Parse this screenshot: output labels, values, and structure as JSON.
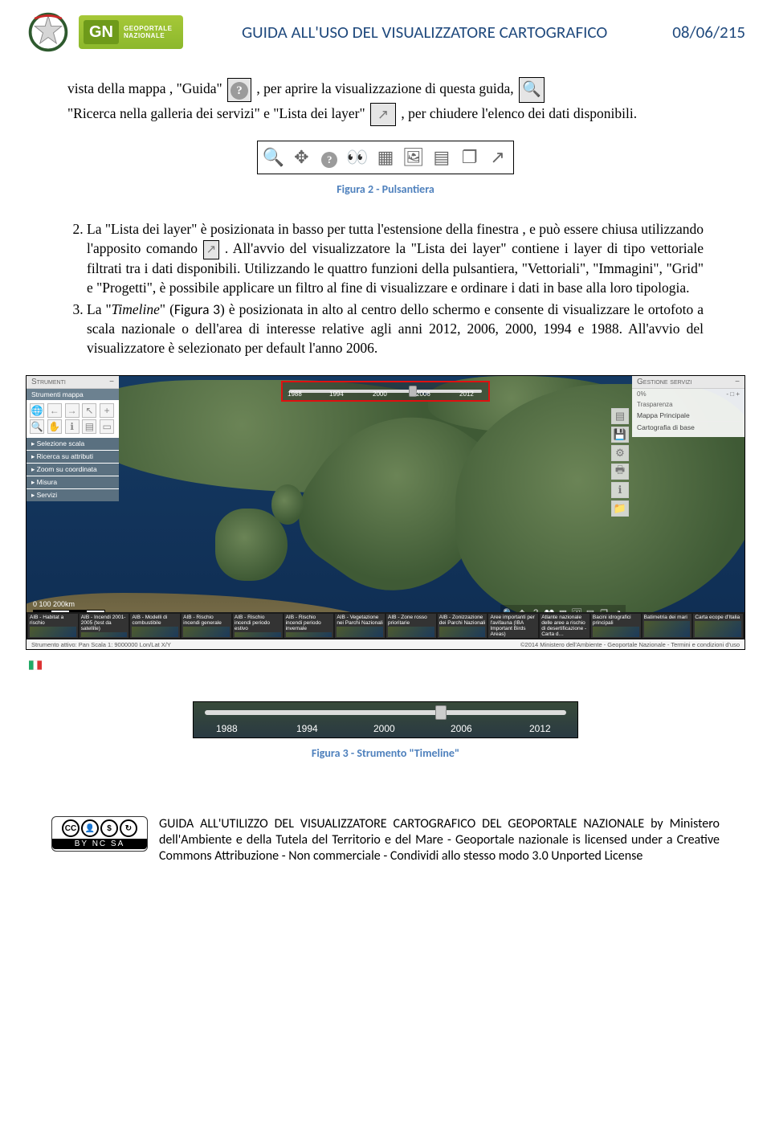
{
  "header": {
    "title": "GUIDA ALL'USO DEL VISUALIZZATORE CARTOGRAFICO",
    "date": "08/06/215",
    "gn_badge_label": "GN",
    "gn_badge_sub1": "GEOPORTALE",
    "gn_badge_sub2": "NAZIONALE"
  },
  "para1": {
    "seg1": "vista della mappa , \"Guida\" ",
    "seg2": ", per aprire la visualizzazione di questa guida,",
    "seg3": "\"Ricerca nella galleria dei servizi\" e \"Lista dei layer\" ",
    "seg4": ", per chiudere l'elenco dei dati disponibili."
  },
  "fig2_caption": "Figura 2 - Pulsantiera",
  "list_item2": {
    "seg1": "La \"Lista dei layer\" è posizionata in basso per tutta l'estensione della finestra , e può essere chiusa utilizzando l'apposito comando ",
    "seg2": ". All'avvio del visualizzatore la \"Lista dei layer\" contiene i layer di tipo vettoriale filtrati tra i dati disponibili. Utilizzando le quattro funzioni della pulsantiera, \"Vettoriali\", \"Immagini\", \"Grid\" e \"Progetti\", è possibile applicare un filtro al fine di visualizzare e ordinare i dati in base alla loro tipologia."
  },
  "list_item3": {
    "seg1": "La ",
    "timeline_word": "Timeline",
    "seg2": " (",
    "figura_ref": "Figura 3",
    "seg3": ") è posizionata in alto al centro dello schermo e consente di visualizzare le ortofoto a scala nazionale o dell'area di interesse relative agli anni 2012, 2006, 2000, 1994 e 1988. All'avvio del visualizzatore è selezionato per default l'anno 2006."
  },
  "map": {
    "left_panel": {
      "header": "Strumenti",
      "sub_header": "Strumenti mappa",
      "items": [
        "Selezione scala",
        "Ricerca su attributi",
        "Zoom su coordinata",
        "Misura",
        "Servizi"
      ]
    },
    "right_panel": {
      "header": "Gestione servizi",
      "tr_label_left": "0%",
      "tr_label_center": "Trasparenza",
      "tr_label_sym": "- □ +",
      "items": [
        "Mappa Principale",
        "Cartografia di base"
      ]
    },
    "timeline_years": [
      "1988",
      "1994",
      "2000",
      "2006",
      "2012"
    ],
    "scale": {
      "vals": "0   100   200km"
    },
    "thumbs": [
      "AIB - Habitat a rischio",
      "AIB - Incendi 2001-2005 (test da satellite)",
      "AIB - Modelli di combustibile",
      "AIB - Rischio incendi generale",
      "AIB - Rischio incendi periodo estivo",
      "AIB - Rischio incendi periodo invernale",
      "AIB - Vegetazione nei Parchi Nazionali",
      "AIB - Zone rosso prioritarie",
      "AIB - Zonizzazione dei Parchi Nazionali",
      "Aree importanti per l'avifauna (IBA Important Birds Areas)",
      "Atlante nazionale delle aree a rischio di desertificazione - Carta d…",
      "Bacini idrografici principali",
      "Batimetria dei mari",
      "Carta ecope d'Italia"
    ],
    "status_left": "Strumento attivo: Pan    Scala 1: 9000000    Lon/Lat    X/Y",
    "status_right": "©2014 Ministero dell'Ambiente - Geoportale Nazionale - Termini e condizioni d'uso"
  },
  "timeline_detail_years": [
    "1988",
    "1994",
    "2000",
    "2006",
    "2012"
  ],
  "fig3_caption": "Figura 3 - Strumento \"Timeline\"",
  "footer": {
    "cc_labels": "BY  NC  SA",
    "text": "GUIDA ALL'UTILIZZO DEL VISUALIZZATORE CARTOGRAFICO DEL GEOPORTALE NAZIONALE by Ministero dell'Ambiente e della Tutela del Territorio e del Mare - Geoportale nazionale is licensed under a Creative Commons Attribuzione - Non commerciale - Condividi allo stesso modo 3.0 Unported License"
  }
}
